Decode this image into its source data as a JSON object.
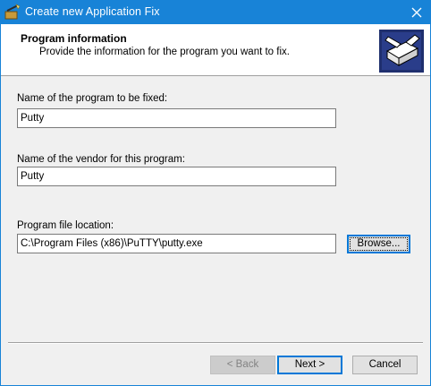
{
  "window": {
    "title": "Create new Application Fix",
    "app_icon": "wizard-wand-icon",
    "close_icon": "close-icon",
    "accent_color": "#1883d7"
  },
  "header": {
    "title": "Program information",
    "subtitle": "Provide the information for the program you want to fix.",
    "image_icon": "application-box-icon"
  },
  "form": {
    "program_name": {
      "label": "Name of the program to be fixed:",
      "value": "Putty"
    },
    "vendor_name": {
      "label": "Name of the vendor for this program:",
      "value": "Putty"
    },
    "file_location": {
      "label": "Program file location:",
      "value": "C:\\Program Files (x86)\\PuTTY\\putty.exe"
    },
    "browse_label": "Browse..."
  },
  "footer": {
    "back_label": "< Back",
    "next_label": "Next >",
    "cancel_label": "Cancel"
  }
}
